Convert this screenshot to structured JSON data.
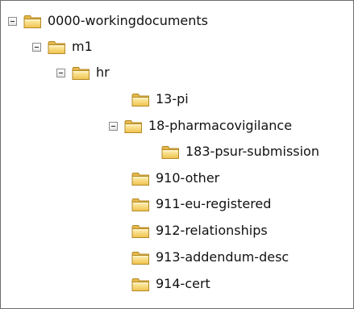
{
  "tree": {
    "nodes": [
      {
        "label": "0000-workingdocuments",
        "expanded": true,
        "icon": "folder-icon"
      },
      {
        "label": "m1",
        "expanded": true,
        "icon": "folder-icon"
      },
      {
        "label": "hr",
        "expanded": true,
        "icon": "folder-icon"
      },
      {
        "label": "13-pi",
        "icon": "folder-icon"
      },
      {
        "label": "18-pharmacovigilance",
        "expanded": true,
        "icon": "folder-icon"
      },
      {
        "label": "183-psur-submission",
        "icon": "folder-icon"
      },
      {
        "label": "910-other",
        "icon": "folder-icon"
      },
      {
        "label": "911-eu-registered",
        "icon": "folder-icon"
      },
      {
        "label": "912-relationships",
        "icon": "folder-icon"
      },
      {
        "label": "913-addendum-desc",
        "icon": "folder-icon"
      },
      {
        "label": "914-cert",
        "icon": "folder-icon"
      }
    ]
  },
  "colors": {
    "folder_fill": "#f7d77c",
    "folder_outline": "#b38a28",
    "border": "#6e6e6e"
  }
}
